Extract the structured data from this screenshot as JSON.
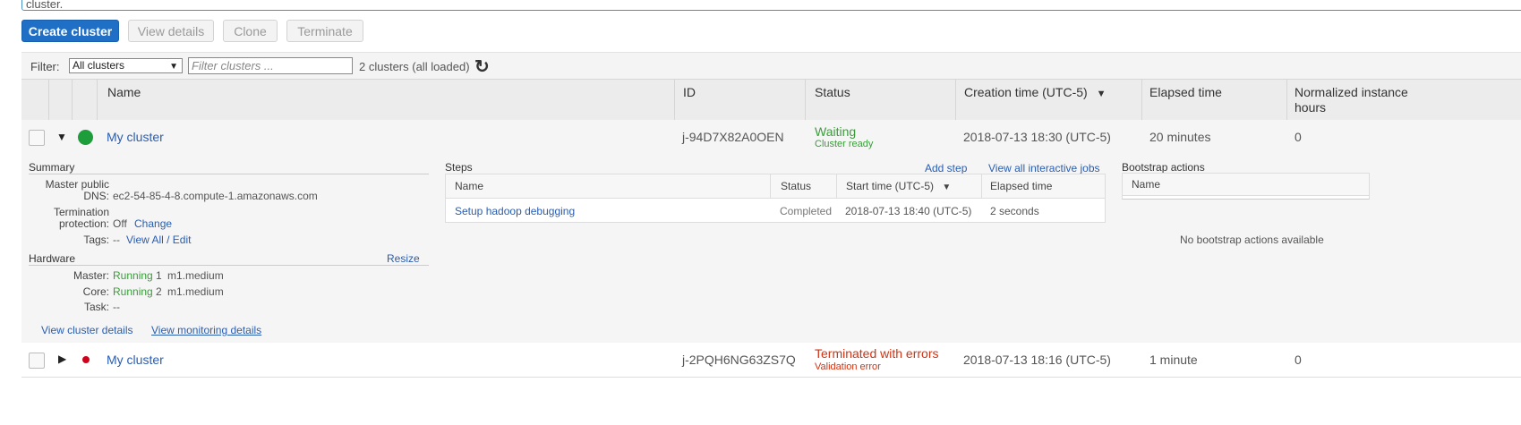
{
  "notice": {
    "text": "cluster."
  },
  "toolbar": {
    "create": "Create cluster",
    "view_details": "View details",
    "clone": "Clone",
    "terminate": "Terminate"
  },
  "filter": {
    "label": "Filter:",
    "selected": "All clusters",
    "placeholder": "Filter clusters ...",
    "count": "2 clusters (all loaded)"
  },
  "columns": {
    "name": "Name",
    "id": "ID",
    "status": "Status",
    "creation": "Creation time (UTC-5)",
    "elapsed": "Elapsed time",
    "norm": "Normalized instance hours"
  },
  "clusters": [
    {
      "name": "My cluster",
      "id": "j-94D7X82A0OEN",
      "status": "Waiting",
      "status_detail": "Cluster ready",
      "creation": "2018-07-13 18:30 (UTC-5)",
      "elapsed": "20 minutes",
      "norm_hours": "0",
      "status_color": "#3b9c3b"
    },
    {
      "name": "My cluster",
      "id": "j-2PQH6NG63ZS7Q",
      "status": "Terminated with errors",
      "status_detail": "Validation error",
      "creation": "2018-07-13 18:16 (UTC-5)",
      "elapsed": "1 minute",
      "norm_hours": "0",
      "status_color": "#d13212"
    }
  ],
  "summary": {
    "title": "Summary",
    "dns_label_1": "Master public",
    "dns_label_2": "DNS:",
    "dns_value": "ec2-54-85-4-8.compute-1.amazonaws.com",
    "term_label_1": "Termination",
    "term_label_2": "protection:",
    "term_value": "Off",
    "term_change": "Change",
    "tags_label": "Tags:",
    "tags_value": "--",
    "tags_link": "View All / Edit"
  },
  "hardware": {
    "title": "Hardware",
    "resize": "Resize",
    "master_label": "Master:",
    "master_state": "Running",
    "master_count": "1",
    "master_type": "m1.medium",
    "core_label": "Core:",
    "core_state": "Running",
    "core_count": "2",
    "core_type": "m1.medium",
    "task_label": "Task:",
    "task_value": "--"
  },
  "links": {
    "cluster_details": "View cluster details",
    "monitoring_details": "View monitoring details"
  },
  "steps": {
    "title": "Steps",
    "add_step": "Add step",
    "view_jobs": "View all interactive jobs",
    "headers": {
      "name": "Name",
      "status": "Status",
      "start": "Start time (UTC-5)",
      "elapsed": "Elapsed time"
    },
    "rows": [
      {
        "name": "Setup hadoop debugging",
        "status": "Completed",
        "start": "2018-07-13 18:40 (UTC-5)",
        "elapsed": "2 seconds"
      }
    ]
  },
  "bootstrap": {
    "title": "Bootstrap actions",
    "header_name": "Name",
    "empty": "No bootstrap actions available"
  }
}
